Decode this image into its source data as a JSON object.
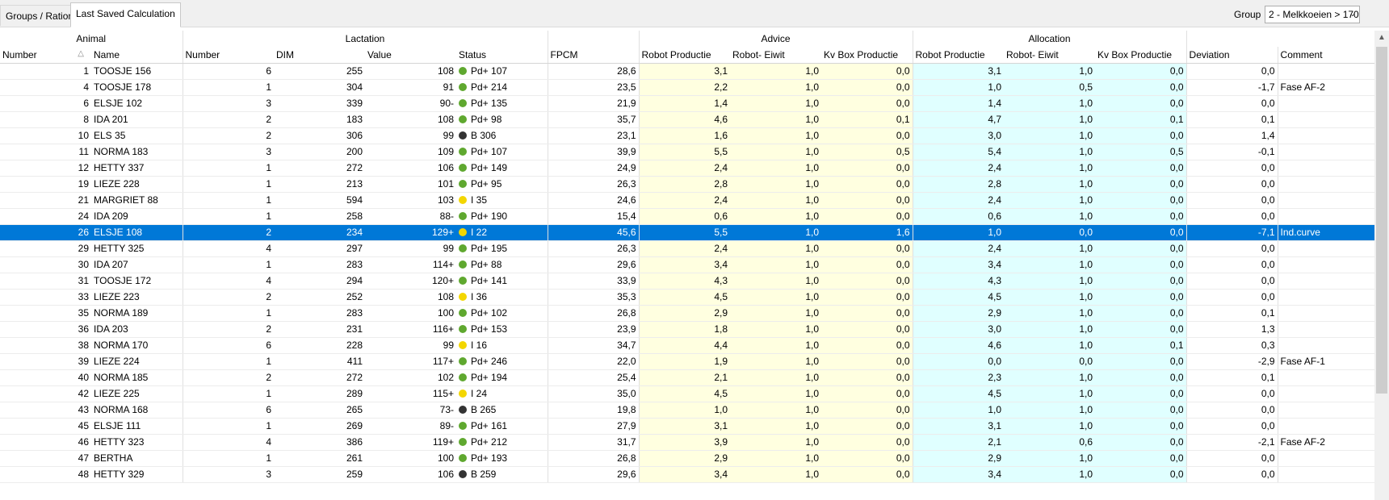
{
  "tabs": [
    {
      "label": "Groups / Rations",
      "active": false
    },
    {
      "label": "Last Saved Calculation",
      "active": true
    }
  ],
  "group": {
    "label": "Group",
    "value": "2 - Melkkoeien > 170"
  },
  "colors": {
    "green": "#5fa82f",
    "black": "#333333",
    "yellow": "#f3d600",
    "selected": "#0078d7",
    "advice": "#ffffe0",
    "allocation": "#e0ffff"
  },
  "header_groups": {
    "animal": "Animal",
    "lactation": "Lactation",
    "advice": "Advice",
    "allocation": "Allocation"
  },
  "columns": [
    "Number",
    "Name",
    "Number",
    "DIM",
    "Value",
    "Status",
    "FPCM",
    "Robot Productie",
    "Robot- Eiwit",
    "Kv Box Productie",
    "Robot Productie",
    "Robot- Eiwit",
    "Kv Box Productie",
    "Deviation",
    "Comment"
  ],
  "rows": [
    {
      "number": "1",
      "name": "TOOSJE 156",
      "lact": "6",
      "dim": "255",
      "value": "108",
      "dot": "green",
      "status": "Pd+ 107",
      "fpcm": "28,6",
      "a1": "3,1",
      "a2": "1,0",
      "a3": "0,0",
      "b1": "3,1",
      "b2": "1,0",
      "b3": "0,0",
      "dev": "0,0",
      "comment": ""
    },
    {
      "number": "4",
      "name": "TOOSJE 178",
      "lact": "1",
      "dim": "304",
      "value": "91",
      "dot": "green",
      "status": "Pd+ 214",
      "fpcm": "23,5",
      "a1": "2,2",
      "a2": "1,0",
      "a3": "0,0",
      "b1": "1,0",
      "b2": "0,5",
      "b3": "0,0",
      "dev": "-1,7",
      "comment": "Fase AF-2"
    },
    {
      "number": "6",
      "name": "ELSJE 102",
      "lact": "3",
      "dim": "339",
      "value": "90-",
      "dot": "green",
      "status": "Pd+ 135",
      "fpcm": "21,9",
      "a1": "1,4",
      "a2": "1,0",
      "a3": "0,0",
      "b1": "1,4",
      "b2": "1,0",
      "b3": "0,0",
      "dev": "0,0",
      "comment": ""
    },
    {
      "number": "8",
      "name": "IDA 201",
      "lact": "2",
      "dim": "183",
      "value": "108",
      "dot": "green",
      "status": "Pd+ 98",
      "fpcm": "35,7",
      "a1": "4,6",
      "a2": "1,0",
      "a3": "0,1",
      "b1": "4,7",
      "b2": "1,0",
      "b3": "0,1",
      "dev": "0,1",
      "comment": ""
    },
    {
      "number": "10",
      "name": "ELS 35",
      "lact": "2",
      "dim": "306",
      "value": "99",
      "dot": "black",
      "status": "B 306",
      "fpcm": "23,1",
      "a1": "1,6",
      "a2": "1,0",
      "a3": "0,0",
      "b1": "3,0",
      "b2": "1,0",
      "b3": "0,0",
      "dev": "1,4",
      "comment": ""
    },
    {
      "number": "11",
      "name": "NORMA 183",
      "lact": "3",
      "dim": "200",
      "value": "109",
      "dot": "green",
      "status": "Pd+ 107",
      "fpcm": "39,9",
      "a1": "5,5",
      "a2": "1,0",
      "a3": "0,5",
      "b1": "5,4",
      "b2": "1,0",
      "b3": "0,5",
      "dev": "-0,1",
      "comment": ""
    },
    {
      "number": "12",
      "name": "HETTY 337",
      "lact": "1",
      "dim": "272",
      "value": "106",
      "dot": "green",
      "status": "Pd+ 149",
      "fpcm": "24,9",
      "a1": "2,4",
      "a2": "1,0",
      "a3": "0,0",
      "b1": "2,4",
      "b2": "1,0",
      "b3": "0,0",
      "dev": "0,0",
      "comment": ""
    },
    {
      "number": "19",
      "name": "LIEZE 228",
      "lact": "1",
      "dim": "213",
      "value": "101",
      "dot": "green",
      "status": "Pd+ 95",
      "fpcm": "26,3",
      "a1": "2,8",
      "a2": "1,0",
      "a3": "0,0",
      "b1": "2,8",
      "b2": "1,0",
      "b3": "0,0",
      "dev": "0,0",
      "comment": ""
    },
    {
      "number": "21",
      "name": "MARGRIET 88",
      "lact": "1",
      "dim": "594",
      "value": "103",
      "dot": "yellow",
      "status": "I 35",
      "fpcm": "24,6",
      "a1": "2,4",
      "a2": "1,0",
      "a3": "0,0",
      "b1": "2,4",
      "b2": "1,0",
      "b3": "0,0",
      "dev": "0,0",
      "comment": ""
    },
    {
      "number": "24",
      "name": "IDA 209",
      "lact": "1",
      "dim": "258",
      "value": "88-",
      "dot": "green",
      "status": "Pd+ 190",
      "fpcm": "15,4",
      "a1": "0,6",
      "a2": "1,0",
      "a3": "0,0",
      "b1": "0,6",
      "b2": "1,0",
      "b3": "0,0",
      "dev": "0,0",
      "comment": ""
    },
    {
      "number": "26",
      "name": "ELSJE 108",
      "lact": "2",
      "dim": "234",
      "value": "129+",
      "dot": "yellow",
      "status": "I 22",
      "fpcm": "45,6",
      "a1": "5,5",
      "a2": "1,0",
      "a3": "1,6",
      "b1": "1,0",
      "b2": "0,0",
      "b3": "0,0",
      "dev": "-7,1",
      "comment": "Ind.curve",
      "selected": true
    },
    {
      "number": "29",
      "name": "HETTY 325",
      "lact": "4",
      "dim": "297",
      "value": "99",
      "dot": "green",
      "status": "Pd+ 195",
      "fpcm": "26,3",
      "a1": "2,4",
      "a2": "1,0",
      "a3": "0,0",
      "b1": "2,4",
      "b2": "1,0",
      "b3": "0,0",
      "dev": "0,0",
      "comment": ""
    },
    {
      "number": "30",
      "name": "IDA 207",
      "lact": "1",
      "dim": "283",
      "value": "114+",
      "dot": "green",
      "status": "Pd+ 88",
      "fpcm": "29,6",
      "a1": "3,4",
      "a2": "1,0",
      "a3": "0,0",
      "b1": "3,4",
      "b2": "1,0",
      "b3": "0,0",
      "dev": "0,0",
      "comment": ""
    },
    {
      "number": "31",
      "name": "TOOSJE 172",
      "lact": "4",
      "dim": "294",
      "value": "120+",
      "dot": "green",
      "status": "Pd+ 141",
      "fpcm": "33,9",
      "a1": "4,3",
      "a2": "1,0",
      "a3": "0,0",
      "b1": "4,3",
      "b2": "1,0",
      "b3": "0,0",
      "dev": "0,0",
      "comment": ""
    },
    {
      "number": "33",
      "name": "LIEZE 223",
      "lact": "2",
      "dim": "252",
      "value": "108",
      "dot": "yellow",
      "status": "I 36",
      "fpcm": "35,3",
      "a1": "4,5",
      "a2": "1,0",
      "a3": "0,0",
      "b1": "4,5",
      "b2": "1,0",
      "b3": "0,0",
      "dev": "0,0",
      "comment": ""
    },
    {
      "number": "35",
      "name": "NORMA 189",
      "lact": "1",
      "dim": "283",
      "value": "100",
      "dot": "green",
      "status": "Pd+ 102",
      "fpcm": "26,8",
      "a1": "2,9",
      "a2": "1,0",
      "a3": "0,0",
      "b1": "2,9",
      "b2": "1,0",
      "b3": "0,0",
      "dev": "0,1",
      "comment": ""
    },
    {
      "number": "36",
      "name": "IDA 203",
      "lact": "2",
      "dim": "231",
      "value": "116+",
      "dot": "green",
      "status": "Pd+ 153",
      "fpcm": "23,9",
      "a1": "1,8",
      "a2": "1,0",
      "a3": "0,0",
      "b1": "3,0",
      "b2": "1,0",
      "b3": "0,0",
      "dev": "1,3",
      "comment": ""
    },
    {
      "number": "38",
      "name": "NORMA 170",
      "lact": "6",
      "dim": "228",
      "value": "99",
      "dot": "yellow",
      "status": "I 16",
      "fpcm": "34,7",
      "a1": "4,4",
      "a2": "1,0",
      "a3": "0,0",
      "b1": "4,6",
      "b2": "1,0",
      "b3": "0,1",
      "dev": "0,3",
      "comment": ""
    },
    {
      "number": "39",
      "name": "LIEZE 224",
      "lact": "1",
      "dim": "411",
      "value": "117+",
      "dot": "green",
      "status": "Pd+ 246",
      "fpcm": "22,0",
      "a1": "1,9",
      "a2": "1,0",
      "a3": "0,0",
      "b1": "0,0",
      "b2": "0,0",
      "b3": "0,0",
      "dev": "-2,9",
      "comment": "Fase AF-1"
    },
    {
      "number": "40",
      "name": "NORMA 185",
      "lact": "2",
      "dim": "272",
      "value": "102",
      "dot": "green",
      "status": "Pd+ 194",
      "fpcm": "25,4",
      "a1": "2,1",
      "a2": "1,0",
      "a3": "0,0",
      "b1": "2,3",
      "b2": "1,0",
      "b3": "0,0",
      "dev": "0,1",
      "comment": ""
    },
    {
      "number": "42",
      "name": "LIEZE 225",
      "lact": "1",
      "dim": "289",
      "value": "115+",
      "dot": "yellow",
      "status": "I 24",
      "fpcm": "35,0",
      "a1": "4,5",
      "a2": "1,0",
      "a3": "0,0",
      "b1": "4,5",
      "b2": "1,0",
      "b3": "0,0",
      "dev": "0,0",
      "comment": ""
    },
    {
      "number": "43",
      "name": "NORMA 168",
      "lact": "6",
      "dim": "265",
      "value": "73-",
      "dot": "black",
      "status": "B 265",
      "fpcm": "19,8",
      "a1": "1,0",
      "a2": "1,0",
      "a3": "0,0",
      "b1": "1,0",
      "b2": "1,0",
      "b3": "0,0",
      "dev": "0,0",
      "comment": ""
    },
    {
      "number": "45",
      "name": "ELSJE 111",
      "lact": "1",
      "dim": "269",
      "value": "89-",
      "dot": "green",
      "status": "Pd+ 161",
      "fpcm": "27,9",
      "a1": "3,1",
      "a2": "1,0",
      "a3": "0,0",
      "b1": "3,1",
      "b2": "1,0",
      "b3": "0,0",
      "dev": "0,0",
      "comment": ""
    },
    {
      "number": "46",
      "name": "HETTY 323",
      "lact": "4",
      "dim": "386",
      "value": "119+",
      "dot": "green",
      "status": "Pd+ 212",
      "fpcm": "31,7",
      "a1": "3,9",
      "a2": "1,0",
      "a3": "0,0",
      "b1": "2,1",
      "b2": "0,6",
      "b3": "0,0",
      "dev": "-2,1",
      "comment": "Fase AF-2"
    },
    {
      "number": "47",
      "name": "BERTHA",
      "lact": "1",
      "dim": "261",
      "value": "100",
      "dot": "green",
      "status": "Pd+ 193",
      "fpcm": "26,8",
      "a1": "2,9",
      "a2": "1,0",
      "a3": "0,0",
      "b1": "2,9",
      "b2": "1,0",
      "b3": "0,0",
      "dev": "0,0",
      "comment": ""
    },
    {
      "number": "48",
      "name": "HETTY 329",
      "lact": "3",
      "dim": "259",
      "value": "106",
      "dot": "black",
      "status": "B 259",
      "fpcm": "29,6",
      "a1": "3,4",
      "a2": "1,0",
      "a3": "0,0",
      "b1": "3,4",
      "b2": "1,0",
      "b3": "0,0",
      "dev": "0,0",
      "comment": ""
    }
  ]
}
